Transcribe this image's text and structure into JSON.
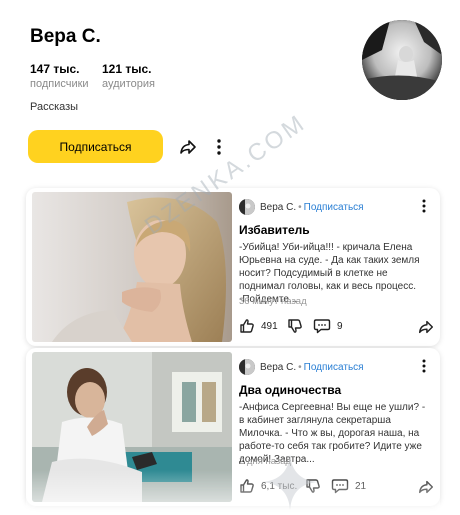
{
  "channel": {
    "name": "Вера С.",
    "subscribers_value": "147 тыс.",
    "subscribers_label": "подписчики",
    "audience_value": "121 тыс.",
    "audience_label": "аудитория",
    "description": "Рассказы",
    "subscribe_label": "Подписаться"
  },
  "watermark_text": "DZENKA.COM",
  "colors": {
    "accent": "#ffd21f",
    "link": "#2a7fd4",
    "muted": "#8a8a8a"
  },
  "posts": [
    {
      "author": "Вера С.",
      "separator": "•",
      "subscribe_label": "Подписаться",
      "title": "Избавитель",
      "text": "-Убийца! Уби-ийца!!! - кричала Елена Юрьевна на суде. - Да как таких земля носит? Подсудимый в клетке не поднимал головы, как и весь процесс. -Пойдемте...",
      "time": "36 минут назад",
      "likes": "491",
      "comments": "9"
    },
    {
      "author": "Вера С.",
      "separator": "•",
      "subscribe_label": "Подписаться",
      "title": "Два одиночества",
      "text": "-Анфиса Сергеевна! Вы еще не ушли? - в кабинет заглянула секретарша Милочка. - Что ж вы, дорогая наша, на работе-то себя так гробите? Идите уже домой! Завтра...",
      "time": "2 дня назад",
      "likes": "6,1 тыс.",
      "comments": "21"
    }
  ]
}
